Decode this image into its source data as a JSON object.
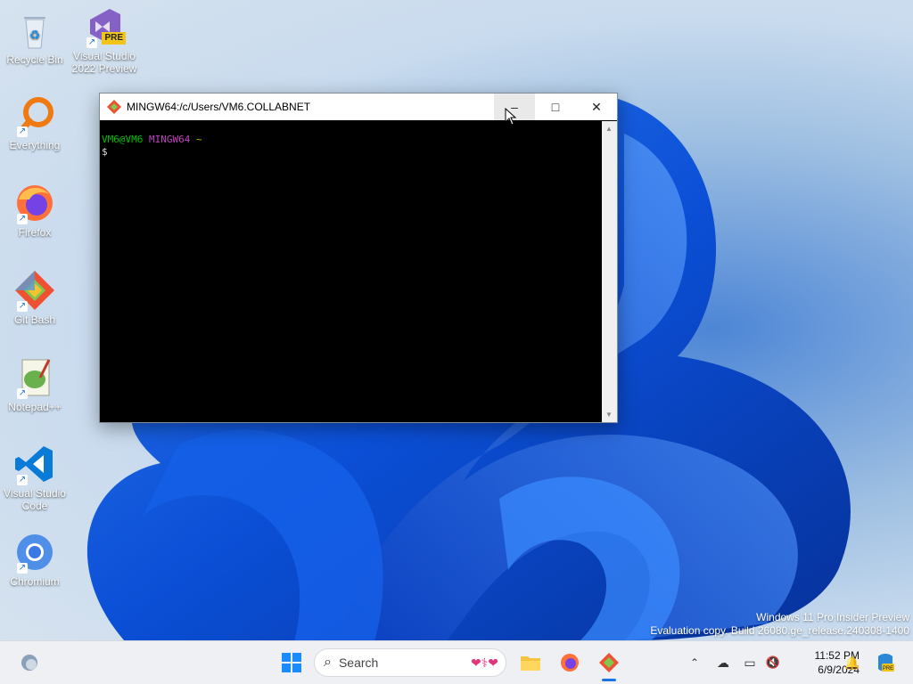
{
  "desktop": {
    "icons": [
      {
        "label": "Recycle Bin",
        "icon": "recycle-bin-icon"
      },
      {
        "label": "Visual Studio 2022 Preview",
        "icon": "visual-studio-icon",
        "badge": "PRE"
      },
      {
        "label": "Everything",
        "icon": "everything-search-icon"
      },
      {
        "label": "Firefox",
        "icon": "firefox-icon"
      },
      {
        "label": "Git Bash",
        "icon": "git-bash-icon"
      },
      {
        "label": "Notepad++",
        "icon": "notepad-plus-plus-icon"
      },
      {
        "label": "Visual Studio Code",
        "icon": "vscode-icon"
      },
      {
        "label": "Chromium",
        "icon": "chromium-icon"
      }
    ]
  },
  "window": {
    "title": "MINGW64:/c/Users/VM6.COLLABNET",
    "prompt_user": "VM6@VM6",
    "prompt_env": "MINGW64",
    "prompt_path": "~",
    "prompt_symbol": "$",
    "controls": {
      "minimize": "–",
      "maximize": "□",
      "close": "✕"
    }
  },
  "watermark": {
    "line1": "Windows 11 Pro Insider Preview",
    "line2": "Evaluation copy. Build 26080.ge_release.240308-1400"
  },
  "taskbar": {
    "search_placeholder": "Search",
    "time": "11:52 PM",
    "date": "6/9/2024"
  },
  "colors": {
    "prompt_user": "#00c000",
    "prompt_env": "#c040c0",
    "prompt_path": "#c0c000",
    "accent": "#1a73e8"
  }
}
